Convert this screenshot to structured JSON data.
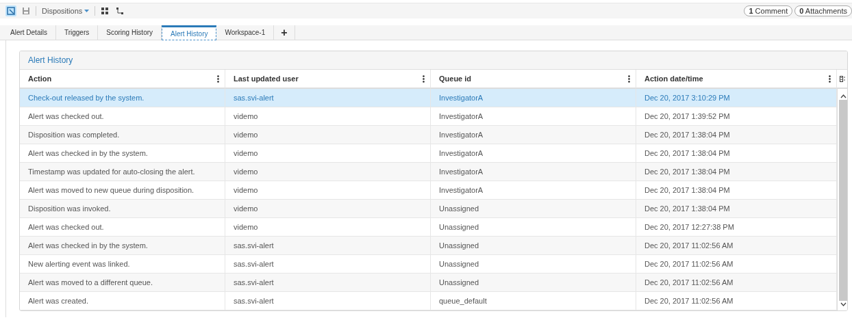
{
  "toolbar": {
    "menu": "Dispositions",
    "badges": [
      "**1** Comment",
      "**0** Attachments"
    ]
  },
  "tabs": [
    {
      "label": "Alert Details",
      "selected": false
    },
    {
      "label": "Triggers",
      "selected": false
    },
    {
      "label": "Scoring History",
      "selected": false
    },
    {
      "label": "Alert History",
      "selected": true
    },
    {
      "label": "Workspace-1",
      "selected": false
    },
    {
      "label": "+",
      "selected": false
    }
  ],
  "panel": {
    "title": "Alert History"
  },
  "table": {
    "columns": [
      "Action",
      "Last updated user",
      "Queue id",
      "Action date/time"
    ],
    "rows": [
      {
        "cells": [
          "Check-out released by the system.",
          "sas.svi-alert",
          "InvestigatorA",
          "Dec 20, 2017 3:10:29 PM"
        ],
        "selected": true
      },
      {
        "cells": [
          "Alert was checked out.",
          "videmo",
          "InvestigatorA",
          "Dec 20, 2017 1:39:52 PM"
        ],
        "selected": false
      },
      {
        "cells": [
          "Disposition was completed.",
          "videmo",
          "InvestigatorA",
          "Dec 20, 2017 1:38:04 PM"
        ],
        "selected": false
      },
      {
        "cells": [
          "Alert was checked in by the system.",
          "videmo",
          "InvestigatorA",
          "Dec 20, 2017 1:38:04 PM"
        ],
        "selected": false
      },
      {
        "cells": [
          "Timestamp was updated for auto-closing the alert.",
          "videmo",
          "InvestigatorA",
          "Dec 20, 2017 1:38:04 PM"
        ],
        "selected": false
      },
      {
        "cells": [
          "Alert was moved to new queue during disposition.",
          "videmo",
          "InvestigatorA",
          "Dec 20, 2017 1:38:04 PM"
        ],
        "selected": false
      },
      {
        "cells": [
          "Disposition was invoked.",
          "videmo",
          "Unassigned",
          "Dec 20, 2017 1:38:04 PM"
        ],
        "selected": false
      },
      {
        "cells": [
          "Alert was checked out.",
          "videmo",
          "Unassigned",
          "Dec 20, 2017 12:27:38 PM"
        ],
        "selected": false
      },
      {
        "cells": [
          "Alert was checked in by the system.",
          "sas.svi-alert",
          "Unassigned",
          "Dec 20, 2017 11:02:56 AM"
        ],
        "selected": false
      },
      {
        "cells": [
          "New alerting event was linked.",
          "sas.svi-alert",
          "Unassigned",
          "Dec 20, 2017 11:02:56 AM"
        ],
        "selected": false
      },
      {
        "cells": [
          "Alert was moved to a different queue.",
          "sas.svi-alert",
          "Unassigned",
          "Dec 20, 2017 11:02:56 AM"
        ],
        "selected": false
      },
      {
        "cells": [
          "Alert was created.",
          "sas.svi-alert",
          "queue_default",
          "Dec 20, 2017 11:02:56 AM"
        ],
        "selected": false
      }
    ]
  }
}
